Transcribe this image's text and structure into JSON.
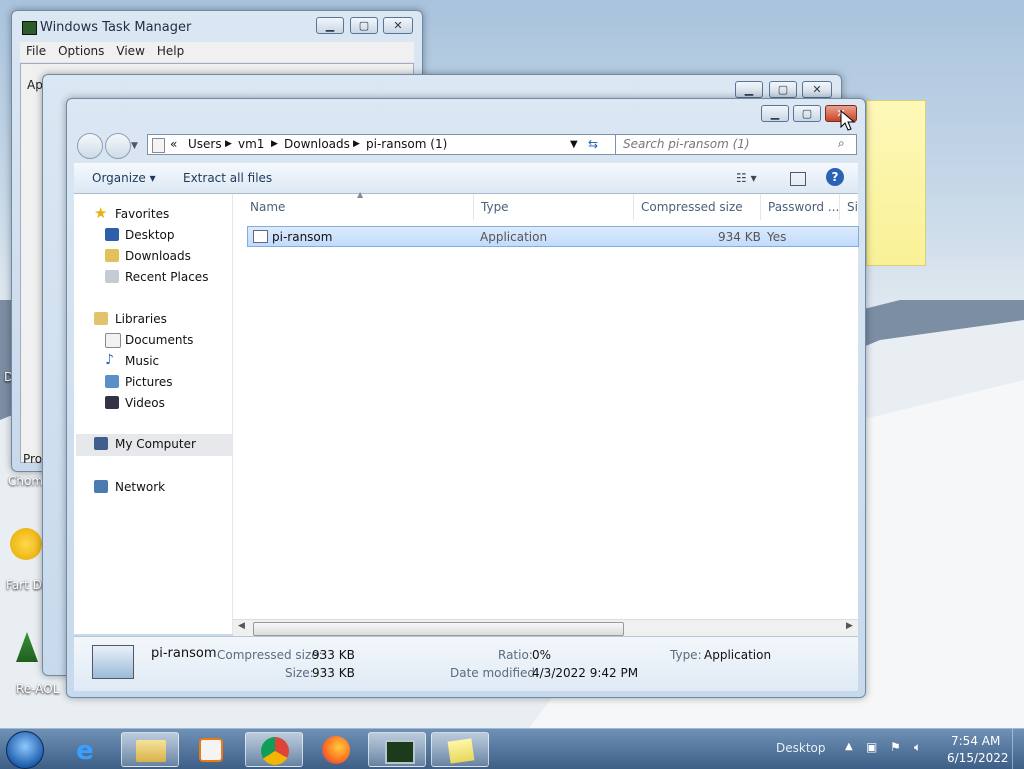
{
  "task_manager": {
    "title": "Windows Task Manager",
    "menu": [
      "File",
      "Options",
      "View",
      "Help"
    ],
    "tab_fragment": "Ap",
    "proc_fragment": "Proc"
  },
  "desktop": {
    "left_fragment": "D",
    "icons": [
      {
        "label": "Chom",
        "icon": "chrome-shortcut-icon"
      },
      {
        "label": "Fart De",
        "icon": "emoji-shortcut-icon"
      },
      {
        "label": "Re-AOL",
        "icon": "aol-shortcut-icon"
      }
    ]
  },
  "explorer": {
    "breadcrumb": [
      "«",
      "Users",
      "vm1",
      "Downloads",
      "pi-ransom (1)"
    ],
    "search_placeholder": "Search pi-ransom (1)",
    "toolbar": {
      "organize": "Organize",
      "extract": "Extract all files"
    },
    "nav": {
      "favorites": "Favorites",
      "favorites_items": [
        "Desktop",
        "Downloads",
        "Recent Places"
      ],
      "libraries": "Libraries",
      "libraries_items": [
        "Documents",
        "Music",
        "Pictures",
        "Videos"
      ],
      "computer": "My Computer",
      "network": "Network"
    },
    "columns": [
      "Name",
      "Type",
      "Compressed size",
      "Password ...",
      "Si"
    ],
    "rows": [
      {
        "name": "pi-ransom",
        "type": "Application",
        "size": "934 KB",
        "password": "Yes"
      }
    ],
    "details": {
      "name": "pi-ransom",
      "compressed_label": "Compressed size:",
      "compressed_value": "933 KB",
      "size_label": "Size:",
      "size_value": "933 KB",
      "ratio_label": "Ratio:",
      "ratio_value": "0%",
      "modified_label": "Date modified:",
      "modified_value": "4/3/2022 9:42 PM",
      "type_label": "Type:",
      "type_value": "Application"
    }
  },
  "taskbar": {
    "desktop_label": "Desktop",
    "time": "7:54 AM",
    "date": "6/15/2022"
  }
}
